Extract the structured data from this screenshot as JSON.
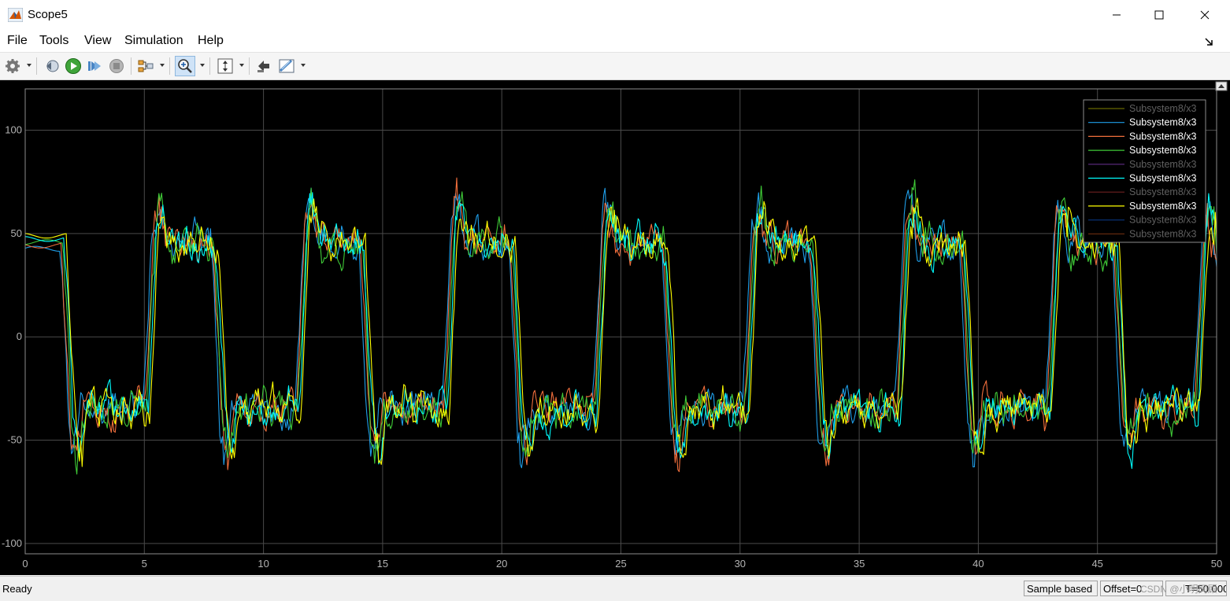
{
  "window": {
    "title": "Scope5"
  },
  "menu": {
    "file": "File",
    "tools": "Tools",
    "view": "View",
    "simulation": "Simulation",
    "help": "Help"
  },
  "toolbar": {
    "icons": [
      "gear-icon",
      "step-back-icon",
      "run-icon",
      "step-forward-icon",
      "stop-icon",
      "signal-selector-icon",
      "zoom-in-icon",
      "scale-axes-icon",
      "highlight-block-icon",
      "measurements-icon"
    ]
  },
  "colors": {
    "plot_bg": "#000000",
    "grid": "#4a4a4a",
    "axis_text": "#b3b3b3",
    "series": [
      "#808000",
      "#1f9ee8",
      "#f06e3c",
      "#3fca37",
      "#7a3aa8",
      "#00ffff",
      "#8a2a2a",
      "#ffff00",
      "#0b3d8f",
      "#8a3a14"
    ]
  },
  "chart_data": {
    "type": "line",
    "xlim": [
      0,
      50
    ],
    "ylim": [
      -105,
      120
    ],
    "x_ticks": [
      "0",
      "5",
      "10",
      "15",
      "20",
      "25",
      "30",
      "35",
      "40",
      "45",
      "50"
    ],
    "y_ticks": [
      "100",
      "50",
      "0",
      "-50",
      "-100"
    ],
    "grid": true,
    "legend_position": "top-right",
    "legend": [
      {
        "name": "Subsystem8/x3",
        "active": false
      },
      {
        "name": "Subsystem8/x3",
        "active": true
      },
      {
        "name": "Subsystem8/x3",
        "active": true
      },
      {
        "name": "Subsystem8/x3",
        "active": true
      },
      {
        "name": "Subsystem8/x3",
        "active": false
      },
      {
        "name": "Subsystem8/x3",
        "active": true
      },
      {
        "name": "Subsystem8/x3",
        "active": false
      },
      {
        "name": "Subsystem8/x3",
        "active": true
      },
      {
        "name": "Subsystem8/x3",
        "active": false
      },
      {
        "name": "Subsystem8/x3",
        "active": false
      }
    ],
    "segments": [
      {
        "t_start": 0.0,
        "t_end": 1.45,
        "level": 45
      },
      {
        "t_start": 1.45,
        "t_end": 4.95,
        "level": -35
      },
      {
        "t_start": 4.95,
        "t_end": 7.8,
        "level": 45
      },
      {
        "t_start": 7.8,
        "t_end": 11.3,
        "level": -35
      },
      {
        "t_start": 11.3,
        "t_end": 14.0,
        "level": 45
      },
      {
        "t_start": 14.0,
        "t_end": 17.5,
        "level": -35
      },
      {
        "t_start": 17.5,
        "t_end": 20.3,
        "level": 45
      },
      {
        "t_start": 20.3,
        "t_end": 23.8,
        "level": -35
      },
      {
        "t_start": 23.8,
        "t_end": 26.7,
        "level": 45
      },
      {
        "t_start": 26.7,
        "t_end": 30.1,
        "level": -35
      },
      {
        "t_start": 30.1,
        "t_end": 32.9,
        "level": 45
      },
      {
        "t_start": 32.9,
        "t_end": 36.5,
        "level": -35
      },
      {
        "t_start": 36.5,
        "t_end": 39.2,
        "level": 45
      },
      {
        "t_start": 39.2,
        "t_end": 42.8,
        "level": -35
      },
      {
        "t_start": 42.8,
        "t_end": 45.6,
        "level": 45
      },
      {
        "t_start": 45.6,
        "t_end": 49.0,
        "level": -35
      },
      {
        "t_start": 49.0,
        "t_end": 50.0,
        "level": 40
      }
    ],
    "noise_amplitude": 12,
    "peak_overshoot": 25
  },
  "status": {
    "ready": "Ready",
    "sample": "Sample based",
    "offset": "Offset=0",
    "time": "T=50.000"
  },
  "watermark": "CSDN @小明同顾"
}
